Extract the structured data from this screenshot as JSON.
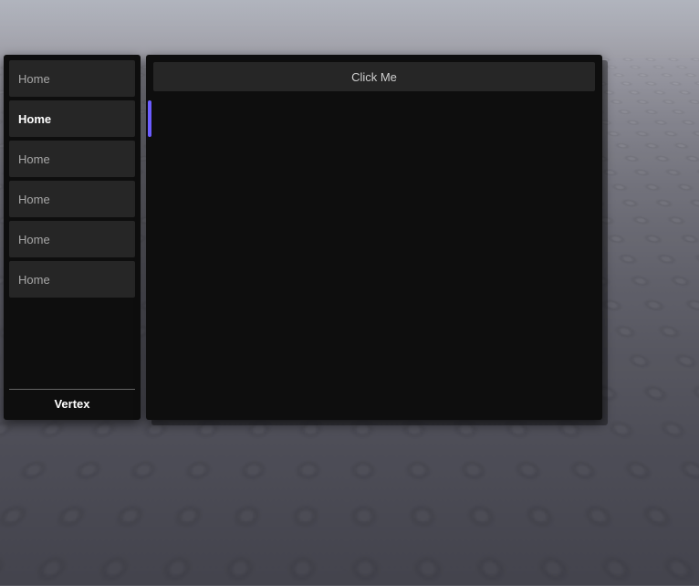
{
  "sidebar": {
    "items": [
      {
        "label": "Home",
        "active": false
      },
      {
        "label": "Home",
        "active": true
      },
      {
        "label": "Home",
        "active": false
      },
      {
        "label": "Home",
        "active": false
      },
      {
        "label": "Home",
        "active": false
      },
      {
        "label": "Home",
        "active": false
      }
    ],
    "footer_label": "Vertex"
  },
  "content": {
    "button_label": "Click Me"
  },
  "colors": {
    "accent": "#6b5cff",
    "panel_bg": "#0e0e0e",
    "item_bg": "#262626"
  }
}
